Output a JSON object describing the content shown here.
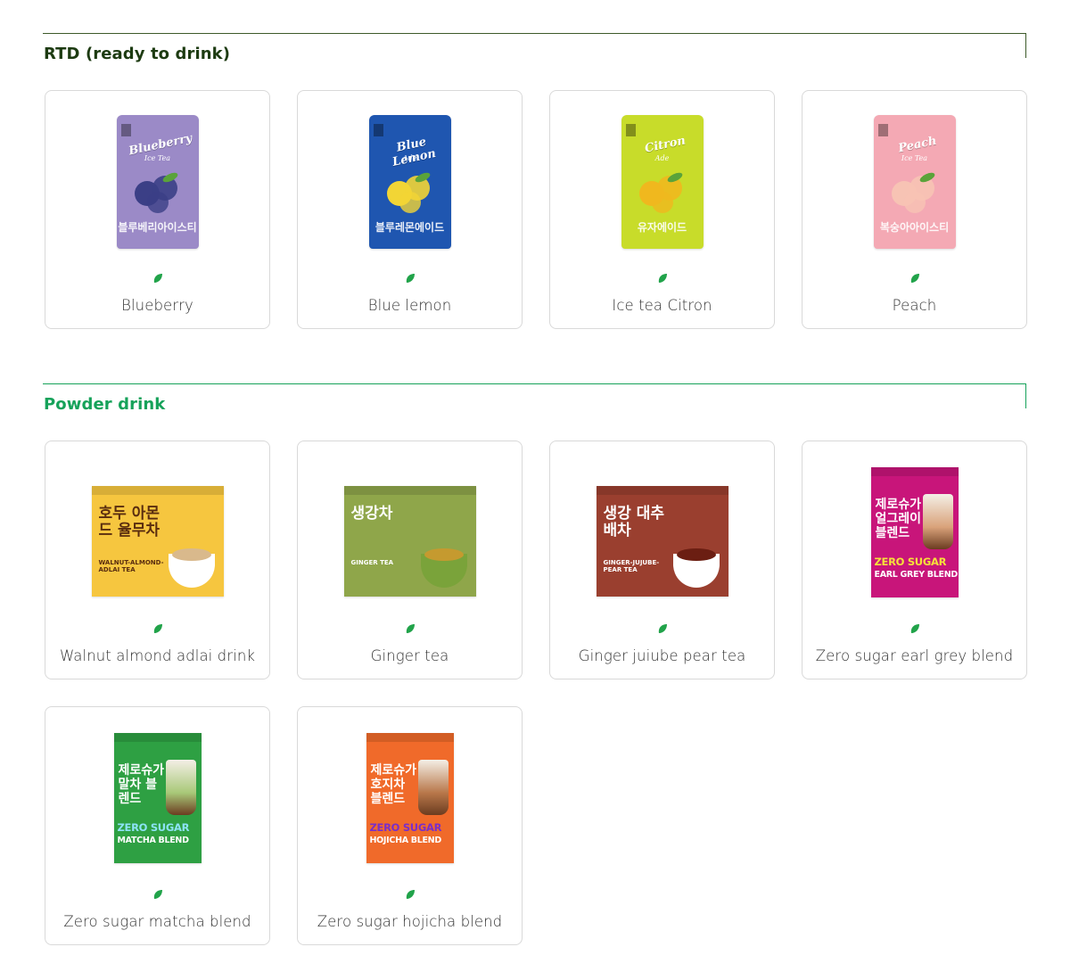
{
  "sections": [
    {
      "title": "RTD (ready to drink)",
      "title_color": "#1d3b12",
      "rule_color": "#3d5a2a",
      "items": [
        {
          "name": "Blueberry",
          "pack": {
            "kind": "pouch",
            "bg": "#9b8ac7",
            "title": "Blueberry",
            "sub": "Ice Tea",
            "ko": "블루베리아이스티",
            "fruit": "#3b3f86"
          }
        },
        {
          "name": "Blue lemon",
          "pack": {
            "kind": "pouch",
            "bg": "#1f56b0",
            "title": "Blue Lemon",
            "sub": "Ade",
            "ko": "블루레몬에이드",
            "fruit": "#f2d535"
          }
        },
        {
          "name": "Ice tea Citron",
          "pack": {
            "kind": "pouch",
            "bg": "#c8dc2a",
            "title": "Citron",
            "sub": "Ade",
            "ko": "유자에이드",
            "fruit": "#f0b81e"
          }
        },
        {
          "name": "Peach",
          "pack": {
            "kind": "pouch",
            "bg": "#f4a9b4",
            "title": "Peach",
            "sub": "Ice Tea",
            "ko": "복숭아아이스티",
            "fruit": "#f7c3b4"
          }
        }
      ]
    },
    {
      "title": "Powder drink",
      "title_color": "#16a25a",
      "rule_color": "#16a25a",
      "items": [
        {
          "name": "Walnut almond adlai drink",
          "pack": {
            "kind": "wide",
            "bg": "#f6c63f",
            "ko": "호두 아몬드 율무차",
            "en": "WALNUT-ALMOND-ADLAI TEA",
            "ink": "#5a2d0f",
            "cup": "#ffffff",
            "drink": "#d9b98c"
          }
        },
        {
          "name": "Ginger tea",
          "pack": {
            "kind": "wide",
            "bg": "#8fa64a",
            "ko": "생강차",
            "en": "GINGER TEA",
            "ink": "#ffffff",
            "cup": "#7aa33a",
            "drink": "#c59a2f"
          }
        },
        {
          "name": "Ginger juiube pear tea",
          "pack": {
            "kind": "wide",
            "bg": "#9a3f2f",
            "ko": "생강 대추배차",
            "en": "GINGER-JUJUBE-PEAR TEA",
            "ink": "#ffffff",
            "cup": "#ffffff",
            "drink": "#6b1e12"
          }
        },
        {
          "name": "Zero sugar earl grey blend",
          "pack": {
            "kind": "tall",
            "bg": "#c8157a",
            "ko": "제로슈가 얼그레이 블렌드",
            "en1": "ZERO SUGAR",
            "en2": "EARL GREY BLEND",
            "ink": "#ffffff",
            "accent": "#f5e13a",
            "glass": "#d9a27a"
          }
        },
        {
          "name": "Zero sugar matcha blend",
          "pack": {
            "kind": "tall",
            "bg": "#2ea043",
            "ko": "제로슈가 말차 블렌드",
            "en1": "ZERO SUGAR",
            "en2": "MATCHA BLEND",
            "ink": "#ffffff",
            "accent": "#8de3f5",
            "glass": "#a8c878"
          }
        },
        {
          "name": "Zero sugar hojicha blend",
          "pack": {
            "kind": "tall",
            "bg": "#f06a2a",
            "ko": "제로슈가 호지차 블렌드",
            "en1": "ZERO SUGAR",
            "en2": "HOJICHA BLEND",
            "ink": "#ffffff",
            "accent": "#7a2ec8",
            "glass": "#b8774a"
          }
        }
      ]
    }
  ],
  "leaf_color": "#21a34a"
}
